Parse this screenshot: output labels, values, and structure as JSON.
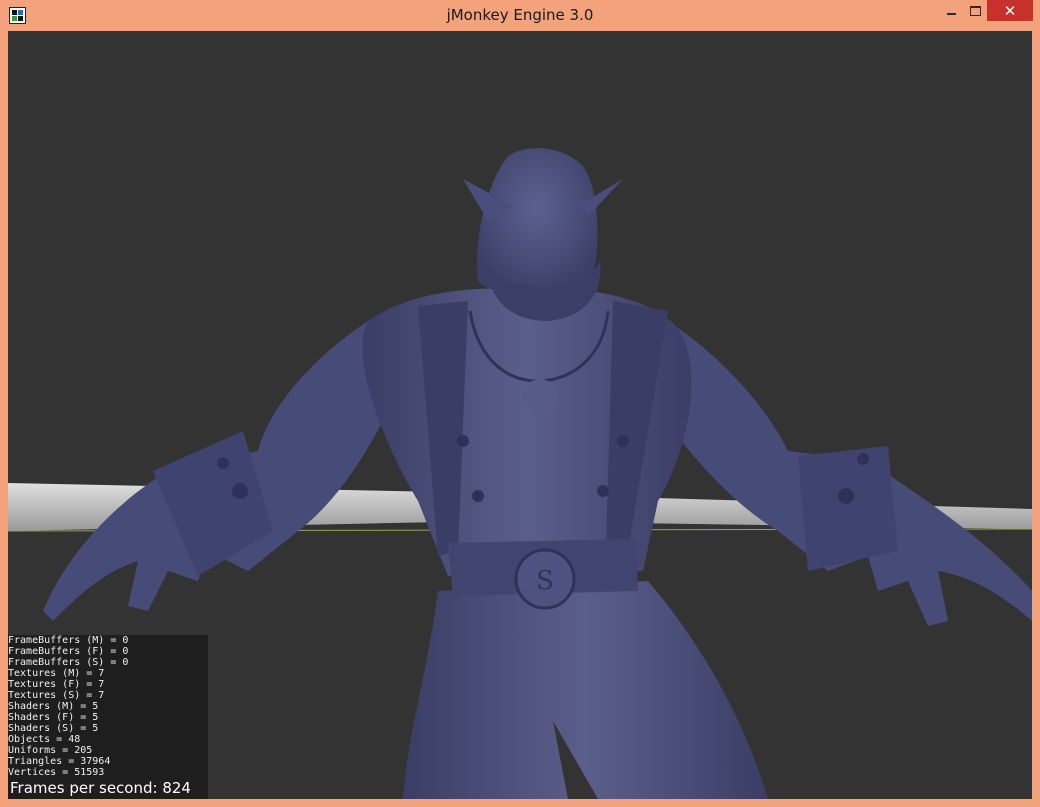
{
  "window": {
    "title": "jMonkey Engine 3.0",
    "frame_color": "#f3a27c",
    "close_color": "#c7312b"
  },
  "controls": {
    "close_glyph": "✕"
  },
  "scene": {
    "background_color": "#333333",
    "model_color": "#4a4e78",
    "floor_color": "#cfcfcf"
  },
  "stats": [
    "FrameBuffers (M) = 0",
    "FrameBuffers (F) = 0",
    "FrameBuffers (S) = 0",
    "Textures (M) = 7",
    "Textures (F) = 7",
    "Textures (S) = 7",
    "Shaders (M) = 5",
    "Shaders (F) = 5",
    "Shaders (S) = 5",
    "Objects = 48",
    "Uniforms = 205",
    "Triangles = 37964",
    "Vertices = 51593"
  ],
  "fps": {
    "text": "Frames per second: 824"
  }
}
